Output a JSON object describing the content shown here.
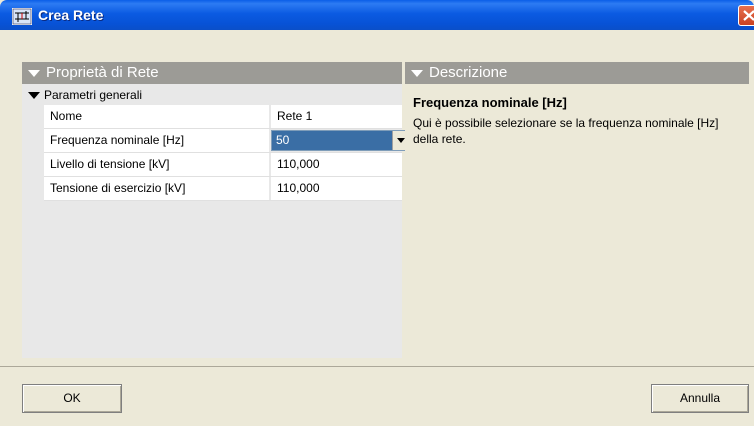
{
  "window": {
    "title": "Crea Rete"
  },
  "properties_panel": {
    "header": "Proprietà di Rete",
    "category": "Parametri generali",
    "rows": [
      {
        "name": "Nome",
        "value": "Rete 1"
      },
      {
        "name": "Frequenza nominale [Hz]",
        "value": "50",
        "type": "dropdown"
      },
      {
        "name": "Livello di tensione [kV]",
        "value": "110,000"
      },
      {
        "name": "Tensione di esercizio [kV]",
        "value": "110,000"
      }
    ]
  },
  "description_panel": {
    "header": "Descrizione",
    "title": "Frequenza nominale [Hz]",
    "text": "Qui è possibile selezionare se la frequenza nominale [Hz] della rete."
  },
  "buttons": {
    "ok": "OK",
    "cancel": "Annulla"
  },
  "icons": {
    "app": "network-app-icon",
    "close": "close-icon",
    "expand": "triangle-down-icon",
    "dropdown": "chevron-down-icon"
  },
  "colors": {
    "titlebar": "#0a5ee8",
    "panel_header": "#9c9b96",
    "selection": "#3a6ea5",
    "close_button": "#d8532f"
  }
}
